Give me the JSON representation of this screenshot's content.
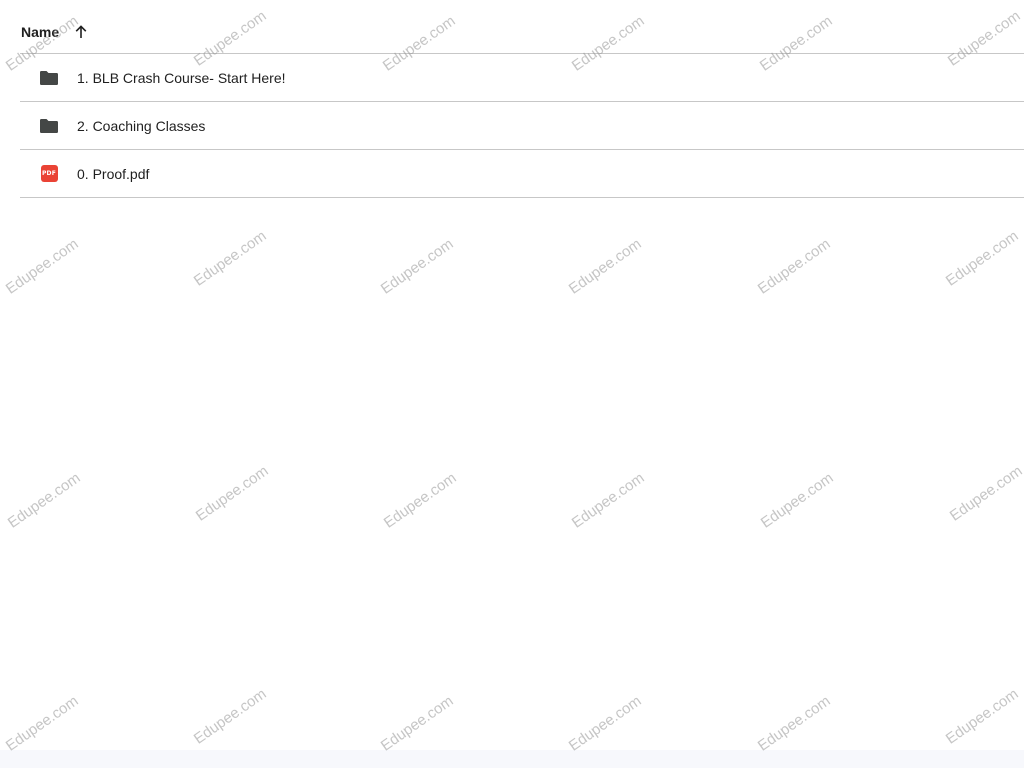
{
  "header": {
    "name_label": "Name",
    "sort_icon": "arrow-upward-icon"
  },
  "rows": [
    {
      "icon": "folder-icon",
      "label": "1. BLB Crash Course- Start Here!"
    },
    {
      "icon": "folder-icon",
      "label": "2. Coaching Classes"
    },
    {
      "icon": "pdf-icon",
      "icon_text": "PDF",
      "label": "0. Proof.pdf"
    }
  ],
  "watermark": {
    "text": "Edupee.com"
  },
  "colors": {
    "folder": "#444746",
    "pdf": "#ea4335",
    "divider": "#c7c7c7",
    "watermark": "#969696"
  }
}
